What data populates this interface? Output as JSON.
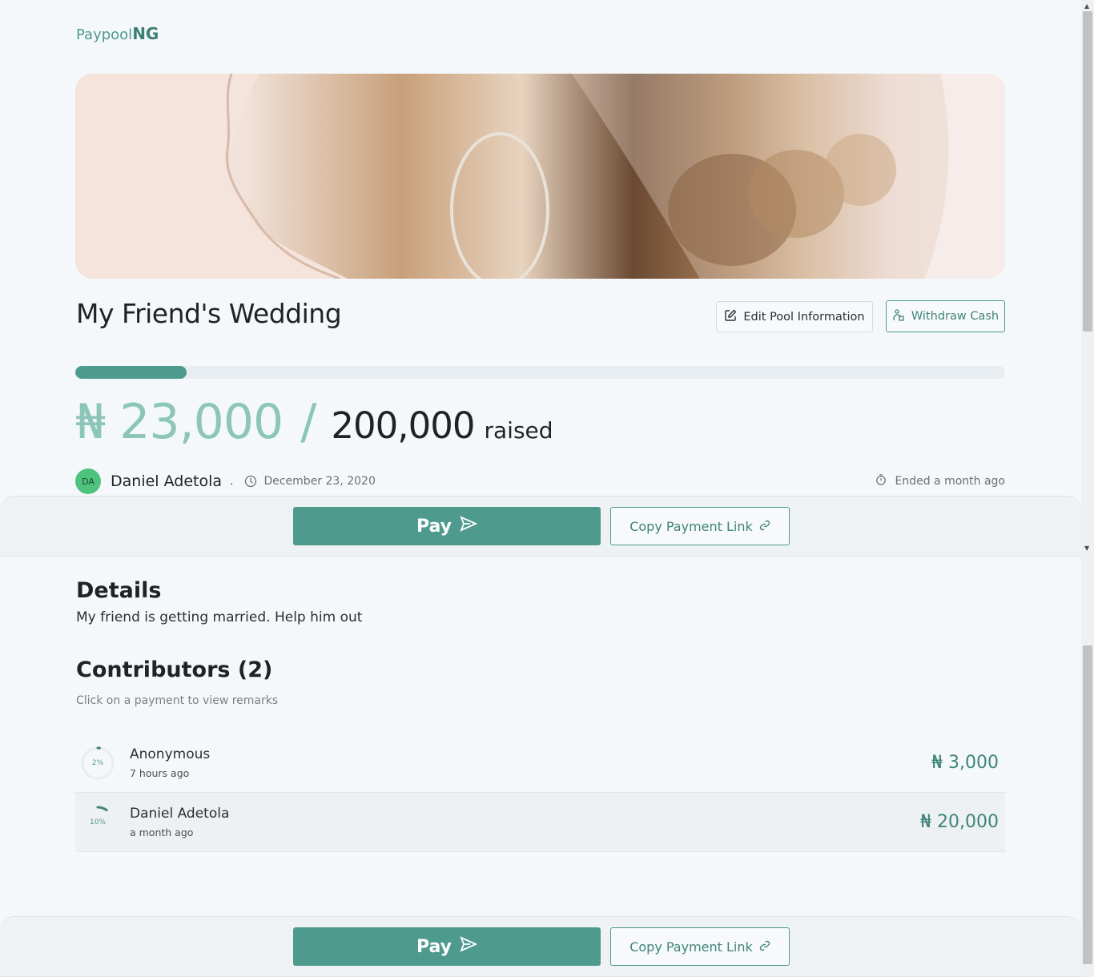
{
  "brand": {
    "part1": "Paypool",
    "part2": "NG"
  },
  "pool": {
    "title": "My Friend's Wedding",
    "raised": "₦ 23,000",
    "slash": "/",
    "target": "200,000",
    "raised_word": "raised",
    "progress_percent": 12,
    "author_initials": "DA",
    "author_name": "Daniel Adetola",
    "separator": ".",
    "date": "December 23, 2020",
    "status": "Ended a month ago"
  },
  "actions": {
    "edit_label": "Edit Pool Information",
    "withdraw_label": "Withdraw Cash",
    "pay_label": "Pay",
    "copy_label": "Copy Payment Link"
  },
  "details": {
    "heading": "Details",
    "text": "My friend is getting married. Help him out"
  },
  "contributors": {
    "heading": "Contributors (2)",
    "subtitle": "Click on a payment to view remarks",
    "items": [
      {
        "name": "Anonymous",
        "time": "7 hours ago",
        "amount": "₦ 3,000",
        "percent_label": "2%",
        "percent": 2
      },
      {
        "name": "Daniel Adetola",
        "time": "a month ago",
        "amount": "₦ 20,000",
        "percent_label": "10%",
        "percent": 10
      }
    ]
  },
  "colors": {
    "accent": "#4e9a8d",
    "accent_light": "#8cc6b9",
    "avatar": "#4fc27d"
  }
}
